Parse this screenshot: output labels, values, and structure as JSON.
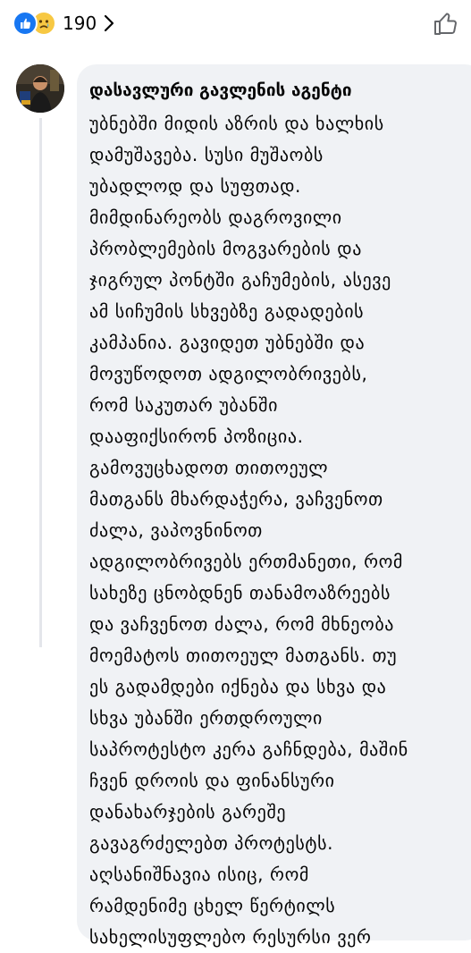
{
  "reactions": {
    "count": "190",
    "types": [
      "like-icon",
      "sad-icon"
    ],
    "like_color": "#1877f2",
    "sad_color": "#f7c843"
  },
  "comment": {
    "author": "დასავლური გავლენის აგენტი",
    "lines": [
      "უბნებში მიდის აზრის და ხალხის",
      "დამუშავება. სუსი მუშაობს",
      "უბადლოდ და სუფთად.",
      "მიმდინარეობს დაგროვილი",
      "პრობლემების მოგვარების და",
      "ჯიგრულ პონტში გაჩუმების, ასევე",
      "ამ სიჩუმის სხვებზე გადადების",
      "კამპანია. გავიდეთ უბნებში და",
      "მოვუწოდოთ ადგილობრივებს,",
      "რომ საკუთარ უბანში",
      "დააფიქსირონ პოზიცია.",
      "გამოვუცხადოთ თითოეულ",
      "მათგანს მხარდაჭერა, ვაჩვენოთ",
      "ძალა, ვაპოვნინოთ",
      "ადგილობრივებს ერთმანეთი, რომ",
      "სახეზე ცნობდნენ თანამოაზრეებს",
      "და ვაჩვენოთ ძალა, რომ მხნეობა",
      "მოემატოს თითოეულ მათგანს. თუ",
      "ეს გადამდები იქნება და სხვა და",
      "სხვა უბანში ერთდროული",
      "საპროტესტო კერა გაჩნდება, მაშინ",
      "ჩვენ დროის და ფინანსური",
      "დანახარჯების გარეშე",
      "გავაგრძელებთ პროტესტს.",
      "აღსანიშნავია ისიც, რომ",
      "რამდენიმე ცხელ წერტილს",
      "სახელისუფლებო რესურსი ვერ"
    ]
  }
}
